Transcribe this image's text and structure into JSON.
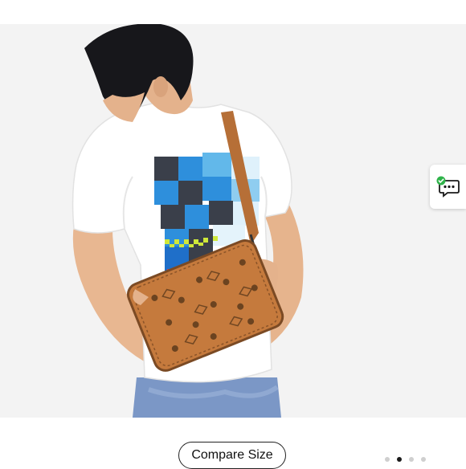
{
  "product_gallery": {
    "image_alt": "",
    "compare_label": "Compare Size",
    "pagination": {
      "total": 4,
      "active_index": 1
    }
  },
  "chat": {
    "icon": "chat-bubble-icon",
    "badge_icon": "check-badge-icon",
    "badge_color": "#2fb34a"
  },
  "colors": {
    "bag": "#c47a3f",
    "shirt": "#ffffff",
    "jeans": "#7a96c4"
  }
}
